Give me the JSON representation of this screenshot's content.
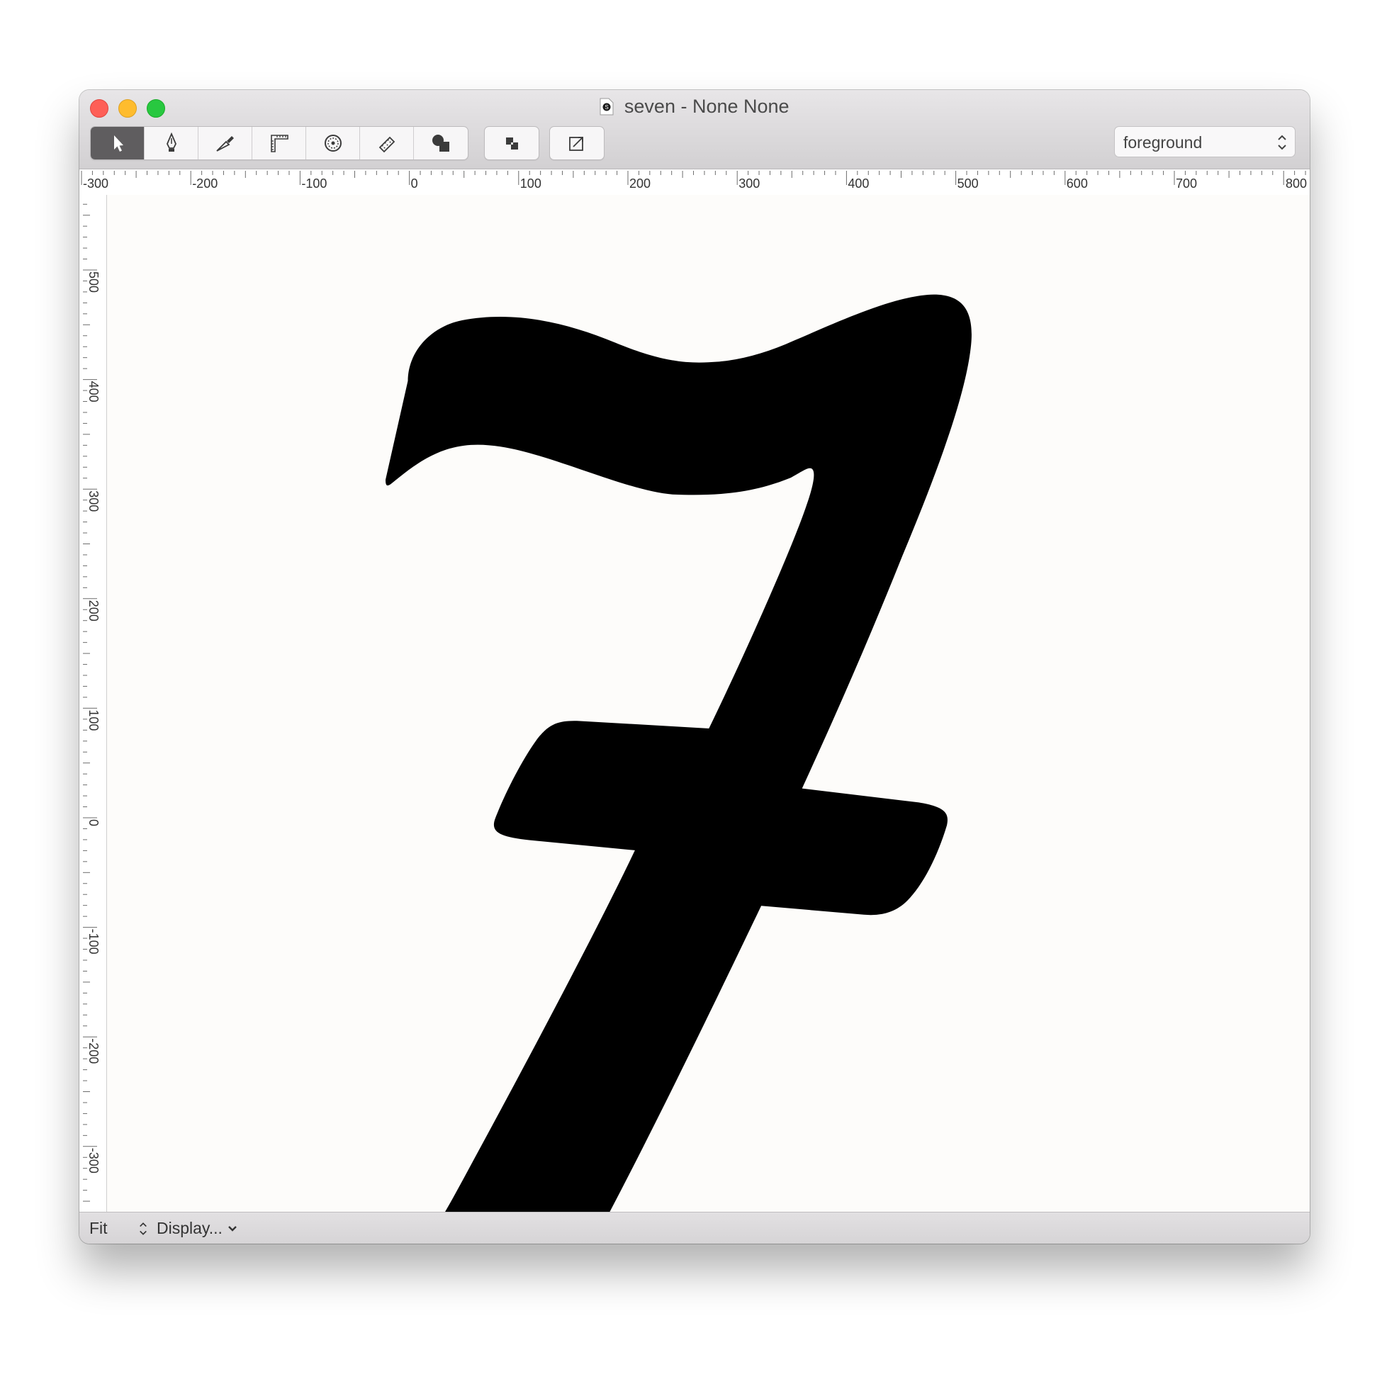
{
  "window": {
    "title": "seven - None None",
    "doc_icon": "glyph-file-icon"
  },
  "toolbar": {
    "tools": [
      {
        "name": "select-tool",
        "icon": "arrow-pointer-icon",
        "active": true
      },
      {
        "name": "pen-tool",
        "icon": "pen-nib-icon",
        "active": false
      },
      {
        "name": "knife-tool",
        "icon": "knife-icon",
        "active": false
      },
      {
        "name": "measure-tool",
        "icon": "ruler-square-icon",
        "active": false
      },
      {
        "name": "primitive-tool",
        "icon": "dotted-circle-icon",
        "active": false
      },
      {
        "name": "eraser-tool",
        "icon": "eraser-icon",
        "active": false
      },
      {
        "name": "shapes-tool",
        "icon": "shapes-icon",
        "active": false
      }
    ],
    "extra_buttons": [
      {
        "name": "layers-button",
        "icon": "layers-icon"
      },
      {
        "name": "anchor-button",
        "icon": "anchor-frame-icon"
      }
    ],
    "layer_select": {
      "value": "foreground"
    }
  },
  "rulers": {
    "horizontal_labels": [
      "-300",
      "-200",
      "-100",
      "0",
      "100",
      "200",
      "300",
      "400",
      "500",
      "600",
      "700",
      "800"
    ],
    "vertical_labels": [
      "500",
      "400",
      "300",
      "200",
      "100",
      "0",
      "-100",
      "-200",
      "-300"
    ]
  },
  "canvas": {
    "glyph": "seven",
    "glyph_color": "#000000",
    "background_color": "#fdfcfa"
  },
  "statusbar": {
    "zoom": "Fit",
    "display": "Display..."
  }
}
